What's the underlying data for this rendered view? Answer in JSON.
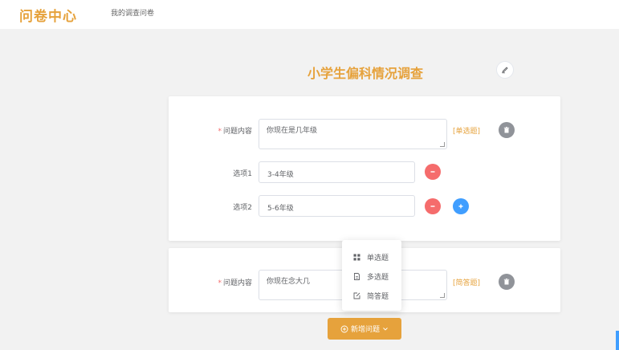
{
  "header": {
    "logo": "问卷中心",
    "nav_link": "我的调查问卷"
  },
  "survey": {
    "title": "小学生偏科情况调查"
  },
  "question1": {
    "label": "问题内容",
    "content": "你现在是几年级",
    "type": "[单选题]",
    "options": [
      {
        "label": "选项1",
        "value": "3-4年级"
      },
      {
        "label": "选项2",
        "value": "5-6年级"
      }
    ]
  },
  "question2": {
    "label": "问题内容",
    "content": "你现在念大几",
    "type": "[简答题]"
  },
  "dropdown": {
    "items": [
      "单选题",
      "多选题",
      "简答题"
    ]
  },
  "add_button": {
    "label": "新增问题"
  },
  "colors": {
    "accent": "#e6a23c",
    "danger": "#f56c6c",
    "primary": "#409eff",
    "info": "#909399"
  },
  "icons": {
    "edit": "pencil-icon",
    "delete": "trash-icon",
    "remove_option": "minus-icon",
    "add_option": "plus-icon",
    "single_choice": "grid-icon",
    "multiple_choice": "document-icon",
    "short_answer": "edit-box-icon",
    "add_circle": "plus-circle-icon",
    "dropdown_arrow": "chevron-down-icon"
  }
}
